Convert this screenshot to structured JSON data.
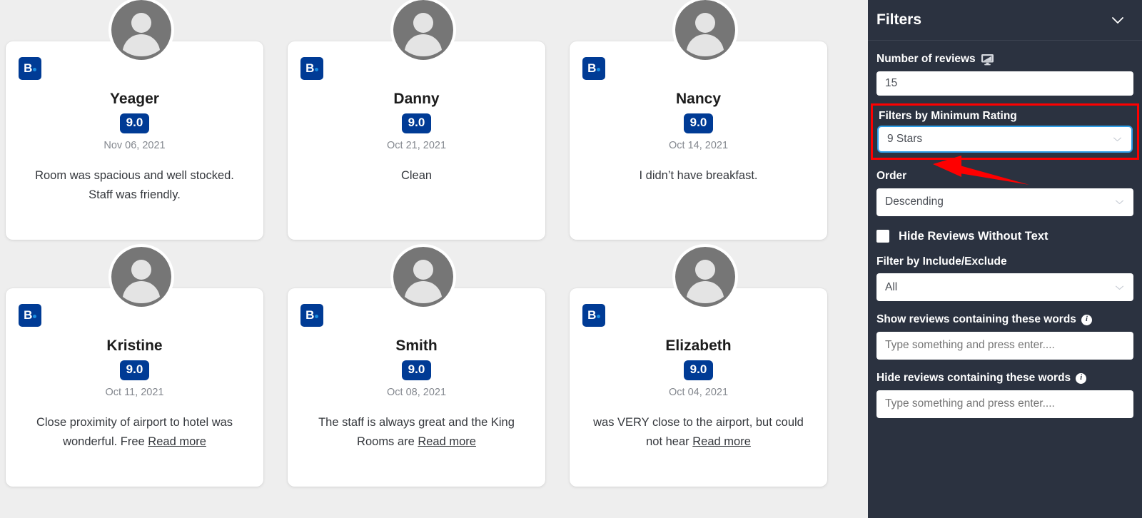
{
  "reviews": [
    {
      "source_badge": "booking-logo",
      "name": "Yeager",
      "score": "9.0",
      "date": "Nov 06, 2021",
      "text": "Room was spacious and well stocked. Staff was friendly.",
      "read_more": ""
    },
    {
      "source_badge": "booking-logo",
      "name": "Danny",
      "score": "9.0",
      "date": "Oct 21, 2021",
      "text": "Clean",
      "read_more": ""
    },
    {
      "source_badge": "booking-logo",
      "name": "Nancy",
      "score": "9.0",
      "date": "Oct 14, 2021",
      "text": "I didn’t have breakfast.",
      "read_more": ""
    },
    {
      "source_badge": "booking-logo",
      "name": "Kristine",
      "score": "9.0",
      "date": "Oct 11, 2021",
      "text": "Close proximity of airport to hotel was wonderful. Free ",
      "read_more": "Read more"
    },
    {
      "source_badge": "booking-logo",
      "name": "Smith",
      "score": "9.0",
      "date": "Oct 08, 2021",
      "text": "The staff is always great and the King Rooms are ",
      "read_more": "Read more"
    },
    {
      "source_badge": "booking-logo",
      "name": "Elizabeth",
      "score": "9.0",
      "date": "Oct 04, 2021",
      "text": "was VERY close to the airport, but could not hear ",
      "read_more": "Read more"
    }
  ],
  "sidebar": {
    "title": "Filters",
    "collapse_icon": "chevron-down-icon",
    "number_of_reviews": {
      "label": "Number of reviews",
      "icon": "monitor-icon",
      "value": "15"
    },
    "minimum_rating": {
      "label": "Filters by Minimum Rating",
      "value": "9 Stars",
      "caret_icon": "chevron-down-icon",
      "highlighted": true
    },
    "order": {
      "label": "Order",
      "value": "Descending",
      "caret_icon": "chevron-down-icon"
    },
    "hide_without_text": {
      "label": "Hide Reviews Without Text",
      "checked": false
    },
    "include_exclude": {
      "label": "Filter by Include/Exclude",
      "value": "All",
      "caret_icon": "chevron-down-icon"
    },
    "show_words": {
      "label": "Show reviews containing these words",
      "info_icon": "info-icon",
      "placeholder": "Type something and press enter....",
      "value": ""
    },
    "hide_words": {
      "label": "Hide reviews containing these words",
      "info_icon": "info-icon",
      "placeholder": "Type something and press enter....",
      "value": ""
    }
  },
  "annotation": {
    "arrow_color": "#ff0000",
    "highlight_color": "#ff0000",
    "target": "9 Stars"
  },
  "colors": {
    "sidebar_bg": "#2b3240",
    "brand_blue": "#003b95",
    "brand_dot": "#1a8fe3",
    "focus_blue": "#2f9fe8",
    "page_bg": "#eeeeee",
    "card_bg": "#ffffff"
  }
}
